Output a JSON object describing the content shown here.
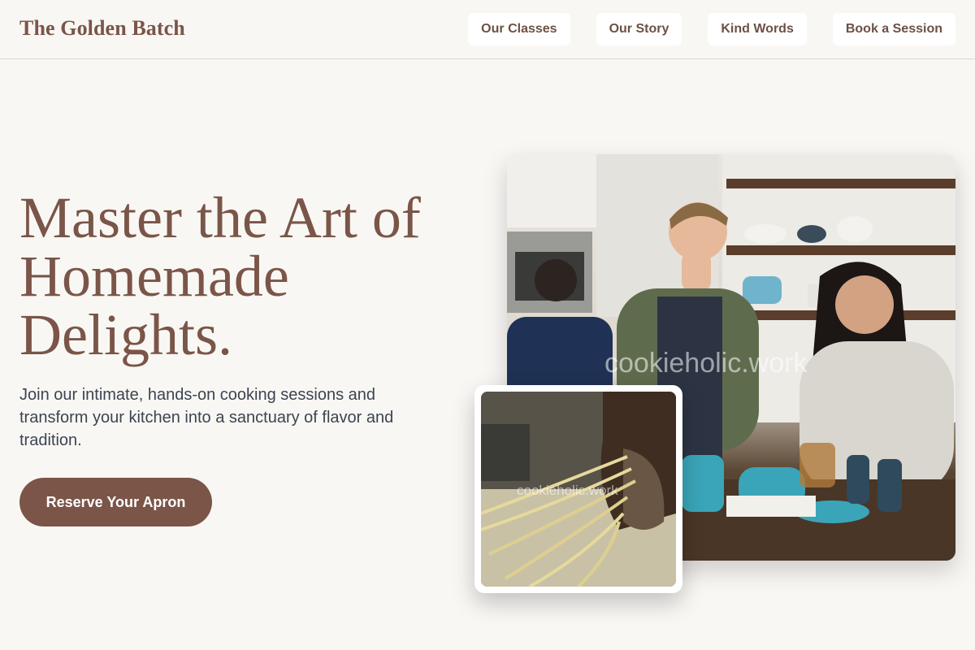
{
  "header": {
    "brand": "The Golden Batch",
    "nav": [
      "Our Classes",
      "Our Story",
      "Kind Words",
      "Book a Session"
    ]
  },
  "hero": {
    "headline_lines": [
      "Master the Art of",
      "Homemade",
      "Delights."
    ],
    "subcopy": "Join our intimate, hands-on cooking sessions and transform your kitchen into a sanctuary of flavor and tradition.",
    "cta": "Reserve Your Apron"
  },
  "images": {
    "watermark_main": "cookieholic.work",
    "watermark_inset": "cookieholic.work"
  },
  "colors": {
    "brand": "#7a5548",
    "background": "#f9f7f4",
    "text": "#3c4450",
    "teal_accent": "#3aa5b8"
  }
}
